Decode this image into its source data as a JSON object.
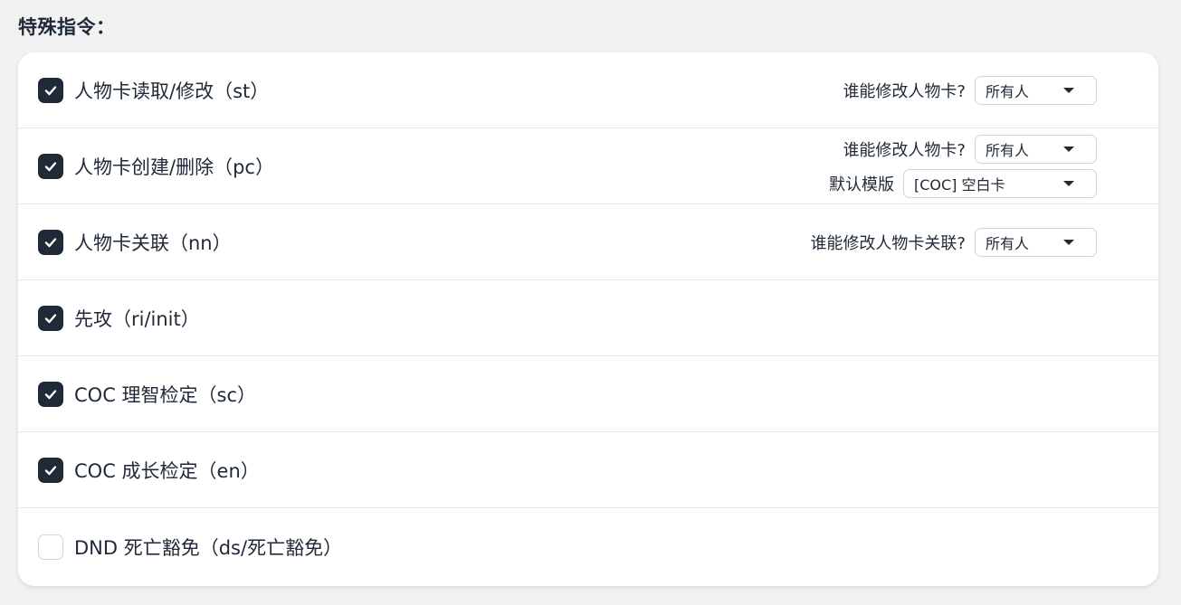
{
  "section_title": "特殊指令：",
  "commands": [
    {
      "label": "人物卡读取/修改（st）",
      "checked": true,
      "settings": [
        {
          "label": "谁能修改人物卡?",
          "value": "所有人"
        }
      ]
    },
    {
      "label": "人物卡创建/删除（pc）",
      "checked": true,
      "settings": [
        {
          "label": "谁能修改人物卡?",
          "value": "所有人"
        },
        {
          "label": "默认模版",
          "value": "[COC] 空白卡"
        }
      ]
    },
    {
      "label": "人物卡关联（nn）",
      "checked": true,
      "settings": [
        {
          "label": "谁能修改人物卡关联?",
          "value": "所有人"
        }
      ]
    },
    {
      "label": "先攻（ri/init）",
      "checked": true,
      "settings": []
    },
    {
      "label": "COC 理智检定（sc）",
      "checked": true,
      "settings": []
    },
    {
      "label": "COC 成长检定（en）",
      "checked": true,
      "settings": []
    },
    {
      "label": "DND 死亡豁免（ds/死亡豁免）",
      "checked": false,
      "settings": []
    }
  ]
}
